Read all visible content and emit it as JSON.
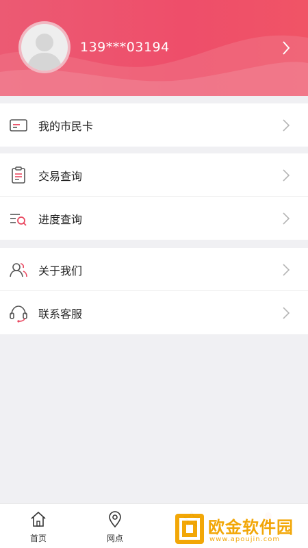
{
  "colors": {
    "header": "#ee4e6a",
    "accent": "#e9475f",
    "background": "#f0f0f3"
  },
  "profile": {
    "phone": "139***03194",
    "avatar_icon": "user-avatar-icon",
    "arrow_icon": "chevron-right-icon"
  },
  "menu_groups": [
    {
      "items": [
        {
          "label": "我的市民卡",
          "icon": "card-icon"
        }
      ]
    },
    {
      "items": [
        {
          "label": "交易查询",
          "icon": "clipboard-icon"
        },
        {
          "label": "进度查询",
          "icon": "list-search-icon"
        }
      ]
    },
    {
      "items": [
        {
          "label": "关于我们",
          "icon": "users-icon"
        },
        {
          "label": "联系客服",
          "icon": "headset-icon"
        }
      ]
    }
  ],
  "tabbar": [
    {
      "label": "首页",
      "icon": "home-icon"
    },
    {
      "label": "网点",
      "icon": "location-pin-icon"
    },
    {
      "label": "",
      "icon": "star-icon"
    },
    {
      "label": "",
      "icon": "person-icon"
    }
  ],
  "watermark": {
    "text": "欧金软件园",
    "sub": "www.apoujin.com"
  }
}
